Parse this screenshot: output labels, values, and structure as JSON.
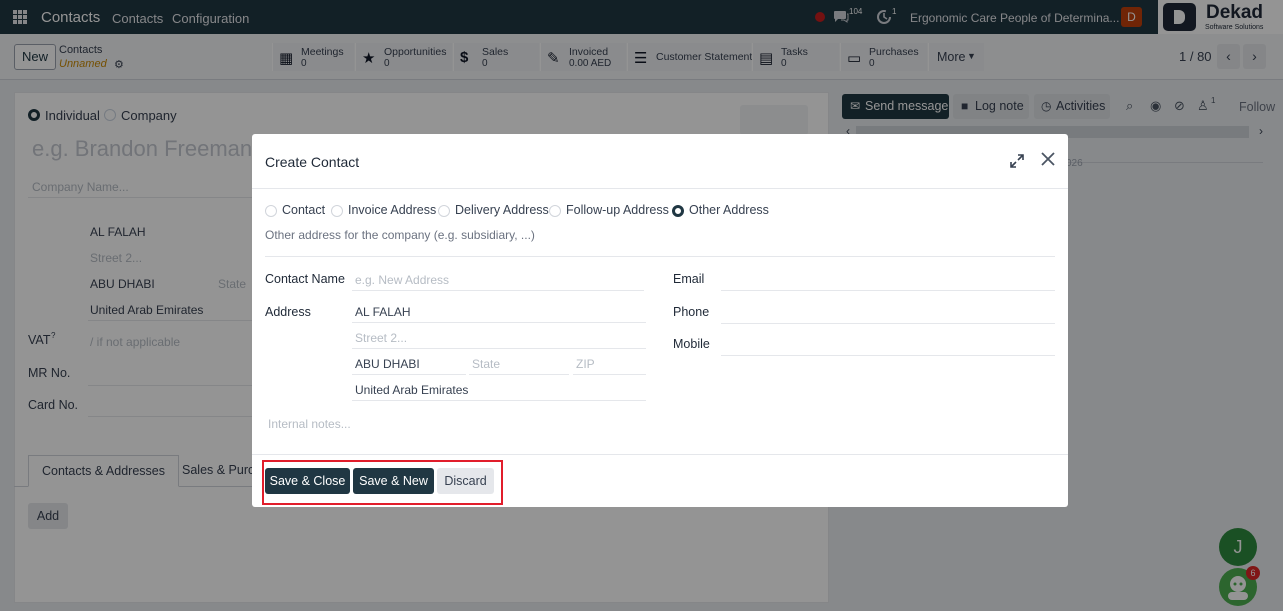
{
  "navbar": {
    "brand": "Contacts",
    "menu": [
      "Contacts",
      "Configuration"
    ],
    "messages_count": "104",
    "activities_count": "1",
    "company": "Ergonomic Care People of Determina...",
    "avatar_initial": "D",
    "logo_name": "Dekad",
    "logo_tagline": "Software Solutions"
  },
  "control": {
    "new_label": "New",
    "breadcrumb_parent": "Contacts",
    "breadcrumb_current": "Unnamed",
    "stats": [
      {
        "label": "Meetings",
        "value": "0",
        "icon": "calendar-icon"
      },
      {
        "label": "Opportunities",
        "value": "0",
        "icon": "star-icon"
      },
      {
        "label": "Sales",
        "value": "0",
        "icon": "dollar-icon"
      },
      {
        "label": "Invoiced",
        "value": "0.00 AED",
        "icon": "edit-icon"
      },
      {
        "label": "Customer Statement",
        "value": "",
        "icon": "list-icon"
      },
      {
        "label": "Tasks",
        "value": "0",
        "icon": "tasks-icon"
      },
      {
        "label": "Purchases",
        "value": "0",
        "icon": "credit-card-icon"
      }
    ],
    "more_label": "More",
    "pager": "1 / 80"
  },
  "form": {
    "type_options": [
      "Individual",
      "Company"
    ],
    "name_placeholder": "e.g. Brandon Freeman",
    "company_placeholder": "Company Name...",
    "street": "AL FALAH",
    "street2_placeholder": "Street 2...",
    "city": "ABU DHABI",
    "state_placeholder": "State",
    "country": "United Arab Emirates",
    "vat_label": "VAT",
    "vat_sup": "?",
    "vat_placeholder": "/ if not applicable",
    "mr_label": "MR No.",
    "card_label": "Card No.",
    "tabs": [
      "Contacts & Addresses",
      "Sales & Purch"
    ],
    "add_label": "Add"
  },
  "chatter": {
    "send_message": "Send message",
    "log_note": "Log note",
    "activities": "Activities",
    "followers_count": "1",
    "follow": "Follow",
    "date_fragment": "026"
  },
  "modal": {
    "title": "Create Contact",
    "address_types": [
      {
        "label": "Contact",
        "selected": false
      },
      {
        "label": "Invoice Address",
        "selected": false
      },
      {
        "label": "Delivery Address",
        "selected": false
      },
      {
        "label": "Follow-up Address",
        "selected": false
      },
      {
        "label": "Other Address",
        "selected": true
      }
    ],
    "type_description": "Other address for the company (e.g. subsidiary, ...)",
    "contact_name_label": "Contact Name",
    "contact_name_placeholder": "e.g. New Address",
    "address_label": "Address",
    "street": "AL FALAH",
    "street2_placeholder": "Street 2...",
    "city": "ABU DHABI",
    "state_placeholder": "State",
    "zip_placeholder": "ZIP",
    "country": "United Arab Emirates",
    "email_label": "Email",
    "phone_label": "Phone",
    "mobile_label": "Mobile",
    "notes_placeholder": "Internal notes...",
    "save_close": "Save & Close",
    "save_new": "Save & New",
    "discard": "Discard"
  },
  "fab": {
    "user_initial": "J",
    "bot_badge": "6"
  },
  "colors": {
    "navbar": "#203743",
    "primary": "#203743",
    "highlight": "#e11d2b",
    "warning": "#ca8a04"
  }
}
